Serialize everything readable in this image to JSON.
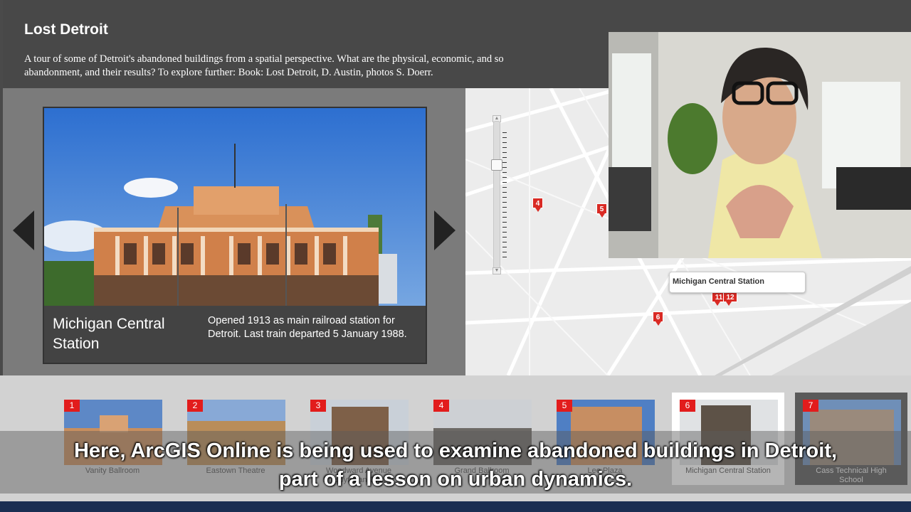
{
  "app": {
    "title": "Lost Detroit",
    "description_line1": "A tour of some of Detroit's abandoned buildings from a spatial perspective. What are the physical, economic, and so",
    "description_line2": "abandonment, and their results? To explore further: Book: Lost Detroit, D. Austin, photos S. Doerr."
  },
  "feature": {
    "title": "Michigan Central Station",
    "description": "Opened 1913 as main railroad station for Detroit. Last train departed 5 January 1988."
  },
  "map": {
    "popup_label": "Michigan Central Station",
    "pins": [
      "4",
      "5",
      "6",
      "11",
      "12"
    ]
  },
  "thumbnails": [
    {
      "num": "1",
      "label": "Vanity Ballroom",
      "color": "#c88f5f"
    },
    {
      "num": "2",
      "label": "Eastown Theatre",
      "color": "#b98d5a"
    },
    {
      "num": "3",
      "label": "Woodward Avenue Presbyterian Church",
      "label_line1": "Woodward Avenue",
      "label_line2": "Presbyterian Church",
      "color": "#7e6048"
    },
    {
      "num": "4",
      "label": "Grand Ballroom",
      "color": "#6d6a66"
    },
    {
      "num": "5",
      "label": "Lee Plaza",
      "color": "#c78e62"
    },
    {
      "num": "6",
      "label": "Michigan Central Station",
      "color": "#5d5247"
    },
    {
      "num": "7",
      "label": "Cass Technical High School",
      "label_line1": "Cass Technical High",
      "label_line2": "School",
      "color": "#9a8a7c"
    }
  ],
  "subtitle": {
    "line1": "Here, ArcGIS Online is being used to examine abandoned buildings in Detroit,",
    "line2": "part of a lesson on urban dynamics."
  },
  "colors": {
    "pin_red": "#d92a24",
    "badge_red": "#e21c1c",
    "header_bg": "#484848"
  }
}
